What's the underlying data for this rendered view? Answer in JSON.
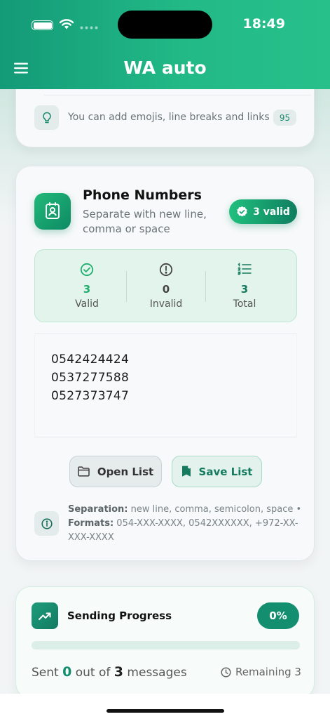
{
  "status_bar": {
    "time": "18:49"
  },
  "header": {
    "title": "WA auto"
  },
  "hint": {
    "text": "You can add emojis, line breaks and links",
    "count": "95"
  },
  "phone": {
    "title": "Phone Numbers",
    "subtitle": "Separate with new line, comma or space",
    "badge": "3 valid",
    "stats": [
      {
        "value": "3",
        "label": "Valid",
        "color": "#1fae6e"
      },
      {
        "value": "0",
        "label": "Invalid",
        "color": "#444444"
      },
      {
        "value": "3",
        "label": "Total",
        "color": "#157a5e"
      }
    ],
    "numbers": [
      "0542424424",
      "0537277588",
      "0527373747"
    ],
    "open_label": "Open List",
    "save_label": "Save List",
    "info_sep_label": "Separation:",
    "info_sep_text": " new line, comma, semicolon, space • ",
    "info_fmt_label": "Formats:",
    "info_fmt_text": " 054-XXX-XXXX, 0542XXXXXX, +972-XX-XXX-XXXX"
  },
  "progress": {
    "title": "Sending Progress",
    "percent_label": "0%",
    "percent": 0,
    "sent_prefix": "Sent ",
    "sent": "0",
    "sent_mid": " out of ",
    "total": "3",
    "sent_suffix": " messages",
    "remaining_label": "Remaining 3"
  },
  "colors": {
    "accent": "#138e6e",
    "header_green": "#22b986"
  }
}
